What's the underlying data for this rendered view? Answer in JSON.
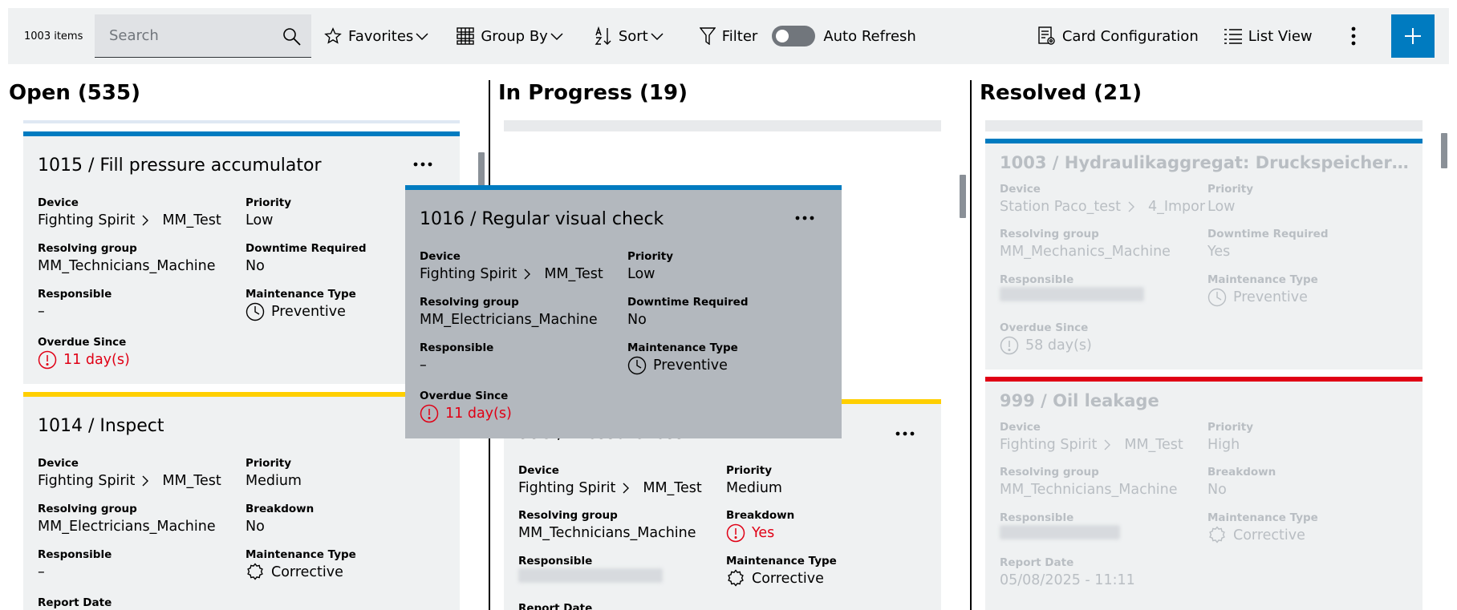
{
  "toolbar": {
    "item_count": "1003 items",
    "search_placeholder": "Search",
    "favorites": "Favorites",
    "group_by": "Group By",
    "sort": "Sort",
    "filter": "Filter",
    "auto_refresh": "Auto Refresh",
    "card_configuration": "Card Configuration",
    "list_view": "List View"
  },
  "labels": {
    "device": "Device",
    "priority": "Priority",
    "resolving_group": "Resolving group",
    "downtime_required": "Downtime Required",
    "breakdown": "Breakdown",
    "responsible": "Responsible",
    "maintenance_type": "Maintenance Type",
    "overdue_since": "Overdue Since",
    "report_date": "Report Date"
  },
  "columns": {
    "open": {
      "title": "Open (535)",
      "cards": [
        {
          "title": "1015 / Fill pressure accumulator",
          "device_a": "Fighting Spirit",
          "device_b": "MM_Test",
          "priority": "Low",
          "resolving_group": "MM_Technicians_Machine",
          "downtime": "No",
          "responsible": "–",
          "maintenance_type": "Preventive",
          "overdue": "11 day(s)"
        },
        {
          "title": "1014 / Inspect",
          "device_a": "Fighting Spirit",
          "device_b": "MM_Test",
          "priority": "Medium",
          "resolving_group": "MM_Electricians_Machine",
          "breakdown": "No",
          "responsible": "–",
          "maintenance_type": "Corrective"
        }
      ]
    },
    "in_progress": {
      "title": "In Progress (19)",
      "cards": [
        {
          "title": "998 / Pressure loss",
          "device_a": "Fighting Spirit",
          "device_b": "MM_Test",
          "priority": "Medium",
          "resolving_group": "MM_Technicians_Machine",
          "breakdown": "Yes",
          "maintenance_type": "Corrective"
        }
      ]
    },
    "resolved": {
      "title": "Resolved (21)",
      "cards": [
        {
          "title": "1003 / Hydraulikaggregat: Druckspeicher B...",
          "device_a": "Station Paco_test",
          "device_b": "4_Impor",
          "priority": "Low",
          "resolving_group": "MM_Mechanics_Machine",
          "downtime": "Yes",
          "maintenance_type": "Preventive",
          "overdue": "58 day(s)"
        },
        {
          "title": "999 / Oil leakage",
          "device_a": "Fighting Spirit",
          "device_b": "MM_Test",
          "priority": "High",
          "resolving_group": "MM_Technicians_Machine",
          "breakdown": "No",
          "maintenance_type": "Corrective",
          "report_date": "05/08/2025 - 11:11"
        }
      ]
    }
  },
  "drag_card": {
    "title": "1016 / Regular visual check",
    "device_a": "Fighting Spirit",
    "device_b": "MM_Test",
    "priority": "Low",
    "resolving_group": "MM_Electricians_Machine",
    "downtime": "No",
    "responsible": "–",
    "maintenance_type": "Preventive",
    "overdue": "11 day(s)"
  },
  "colors": {
    "accent": "#007bc0",
    "status_blue": "#007bc0",
    "status_yellow": "#ffcf00",
    "status_red": "#e00015",
    "alert_red": "#e00015"
  },
  "icons": [
    "search-icon",
    "star-icon",
    "group-by-icon",
    "sort-icon",
    "filter-icon",
    "card-config-icon",
    "list-view-icon",
    "kebab-icon",
    "plus-icon",
    "clock-icon",
    "alert-icon",
    "gear-icon",
    "chevron-right-icon",
    "chevron-down-icon"
  ]
}
